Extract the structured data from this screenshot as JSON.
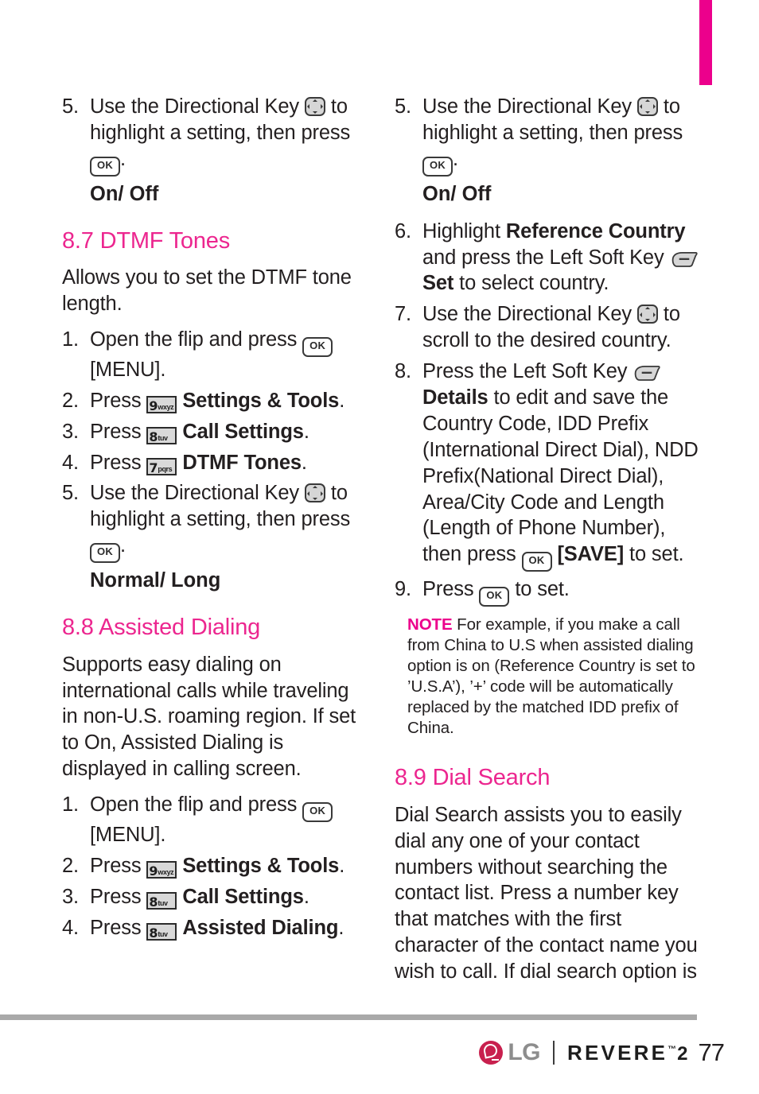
{
  "page": {
    "number": "77",
    "accent_pink": "#ec008c",
    "heading_pink": "#ec268f",
    "rule_gray": "#a9a9a9"
  },
  "footer": {
    "brand": "LG",
    "model": "REVERE",
    "trademark": "™",
    "model_number": "2",
    "page_number": "77"
  },
  "icons": {
    "ok": {
      "label": "OK",
      "name": "ok-key-icon"
    },
    "directional": {
      "name": "directional-key-icon"
    },
    "soft_key": {
      "name": "left-soft-key-icon"
    },
    "key9": {
      "digit": "9",
      "letters": "wxyz"
    },
    "key8": {
      "digit": "8",
      "letters": "tuv"
    },
    "key7": {
      "digit": "7",
      "letters": "pqrs"
    }
  },
  "left_column": {
    "step5_top": {
      "num": "5.",
      "part1": "Use the Directional Key",
      "part2": "to highlight a setting, then press",
      "part3": "."
    },
    "sub_onoff": "On/ Off",
    "section_87": {
      "heading": "8.7 DTMF Tones",
      "intro": "Allows you to set the DTMF tone length.",
      "steps": [
        {
          "num": "1.",
          "pre": "Open the flip and press",
          "post": "[MENU]."
        },
        {
          "num": "2.",
          "pre": "Press",
          "key": "9",
          "letters": "wxyz",
          "bold": "Settings & Tools",
          "post": "."
        },
        {
          "num": "3.",
          "pre": "Press",
          "key": "8",
          "letters": "tuv",
          "bold": "Call Settings",
          "post": "."
        },
        {
          "num": "4.",
          "pre": "Press",
          "key": "7",
          "letters": "pqrs",
          "bold": "DTMF Tones",
          "post": "."
        }
      ],
      "step5": {
        "num": "5.",
        "part1": "Use the Directional Key",
        "part2": "to highlight a setting, then press",
        "part3": "."
      },
      "sub": "Normal/ Long"
    },
    "section_88": {
      "heading": "8.8 Assisted Dialing",
      "intro": "Supports easy dialing on international calls while traveling in non-U.S. roaming region. If set to On, Assisted Dialing is displayed in calling screen.",
      "steps": [
        {
          "num": "1.",
          "pre": "Open the flip and press",
          "post": "[MENU]."
        },
        {
          "num": "2.",
          "pre": "Press",
          "key": "9",
          "letters": "wxyz",
          "bold": "Settings & Tools",
          "post": "."
        },
        {
          "num": "3.",
          "pre": "Press",
          "key": "8",
          "letters": "tuv",
          "bold": "Call Settings",
          "post": "."
        },
        {
          "num": "4.",
          "pre": "Press",
          "key": "8",
          "letters": "tuv",
          "bold": "Assisted Dialing",
          "post": "."
        }
      ]
    }
  },
  "right_column": {
    "step5_top": {
      "num": "5.",
      "part1": "Use the Directional Key",
      "part2": "to highlight a setting, then press",
      "part3": "."
    },
    "sub_onoff": "On/ Off",
    "step6": {
      "num": "6.",
      "pre": "Highlight",
      "bold1": "Reference Country",
      "mid": "and press the Left Soft Key",
      "bold2": "Set",
      "post": "to select country."
    },
    "step7": {
      "num": "7.",
      "pre": "Use the Directional Key",
      "post": "to scroll to the desired country."
    },
    "step8": {
      "num": "8.",
      "pre": "Press the Left Soft Key",
      "bold1": "Details",
      "mid": "to edit and save the Country Code, IDD Prefix (International Direct Dial), NDD Prefix(National Direct Dial), Area/City Code and Length (Length of Phone Number), then press",
      "bold2": "[SAVE]",
      "post": "to set."
    },
    "step9": {
      "num": "9.",
      "pre": "Press",
      "post": "to set."
    },
    "note": {
      "tag": "NOTE",
      "text": "For example, if you make a call from China to U.S when assisted dialing option is on (Reference Country is set to ’U.S.A’), ’+’ code will be automatically replaced by the matched IDD prefix of China."
    },
    "section_89": {
      "heading": "8.9 Dial Search",
      "intro": "Dial Search assists you to easily dial any one of your contact numbers without searching the contact list. Press a number key that matches with the first character of the contact name you wish to call. If dial search option is"
    }
  }
}
